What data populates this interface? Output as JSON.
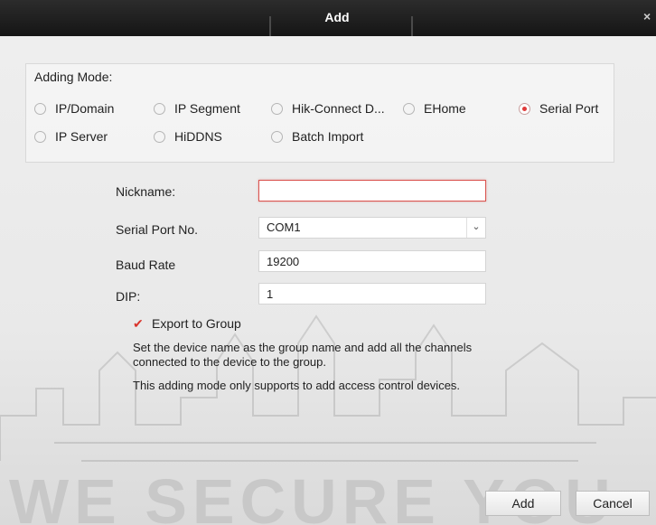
{
  "window": {
    "title": "Add",
    "close_glyph": "×"
  },
  "adding_mode": {
    "label": "Adding Mode:",
    "options": [
      {
        "label": "IP/Domain",
        "selected": false
      },
      {
        "label": "IP Segment",
        "selected": false
      },
      {
        "label": "Hik-Connect D...",
        "selected": false
      },
      {
        "label": "EHome",
        "selected": false
      },
      {
        "label": "Serial Port",
        "selected": true
      },
      {
        "label": "IP Server",
        "selected": false
      },
      {
        "label": "HiDDNS",
        "selected": false
      },
      {
        "label": "Batch Import",
        "selected": false
      }
    ]
  },
  "form": {
    "nickname": {
      "label": "Nickname:",
      "value": ""
    },
    "serial_port": {
      "label": "Serial Port No.",
      "value": "COM1"
    },
    "baud_rate": {
      "label": "Baud Rate",
      "value": "19200"
    },
    "dip": {
      "label": "DIP:",
      "value": "1"
    },
    "export_to_group": {
      "label": "Export to Group",
      "checked": true
    }
  },
  "notes": {
    "line1": "Set the device name as the group name and add all the channels",
    "line2": "connected to the device to the group.",
    "line3": "This adding mode only supports to add access control devices."
  },
  "buttons": {
    "add": "Add",
    "cancel": "Cancel"
  },
  "watermark": "WE SECURE YOU",
  "colors": {
    "accent": "#e03a3a",
    "titlebar": "#1e1e1e"
  }
}
